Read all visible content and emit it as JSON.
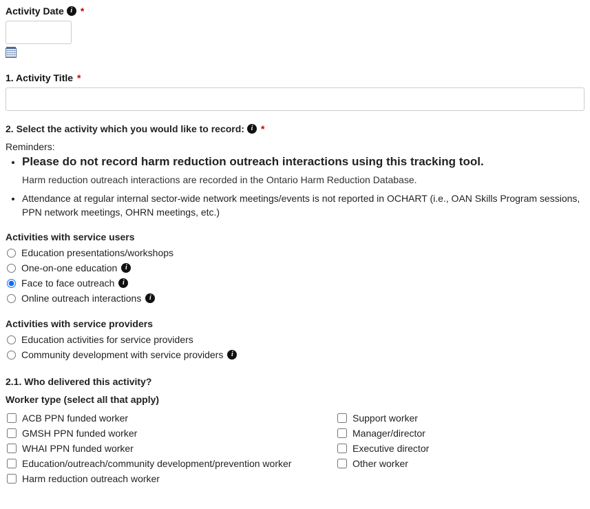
{
  "activity_date": {
    "label": "Activity Date",
    "value": ""
  },
  "activity_title": {
    "label": "1. Activity Title",
    "value": ""
  },
  "activity_select": {
    "label": "2. Select the activity which you would like to record:",
    "reminders_title": "Reminders:",
    "reminder1_bold": "Please do not record harm reduction outreach interactions using this tracking tool.",
    "reminder1_sub": "Harm reduction outreach interactions are recorded in the Ontario Harm Reduction Database.",
    "reminder2": "Attendance at regular internal sector-wide network meetings/events is not reported in OCHART (i.e., OAN Skills Program sessions, PPN network meetings, OHRN meetings, etc.)",
    "group1_heading": "Activities with service users",
    "group1": [
      {
        "label": "Education presentations/workshops",
        "has_info": false,
        "selected": false
      },
      {
        "label": "One-on-one education",
        "has_info": true,
        "selected": false
      },
      {
        "label": "Face to face outreach",
        "has_info": true,
        "selected": true
      },
      {
        "label": "Online outreach interactions",
        "has_info": true,
        "selected": false
      }
    ],
    "group2_heading": "Activities with service providers",
    "group2": [
      {
        "label": "Education activities for service providers",
        "has_info": false,
        "selected": false
      },
      {
        "label": "Community development with service providers",
        "has_info": true,
        "selected": false
      }
    ]
  },
  "q21": {
    "heading": "2.1. Who delivered this activity?",
    "sub_label": "Worker type (select all that apply)",
    "col_a": [
      "ACB PPN funded worker",
      "GMSH PPN funded worker",
      "WHAI PPN funded worker",
      "Education/outreach/community development/prevention worker",
      "Harm reduction outreach worker"
    ],
    "col_b": [
      "Support worker",
      "Manager/director",
      "Executive director",
      "Other worker"
    ]
  }
}
